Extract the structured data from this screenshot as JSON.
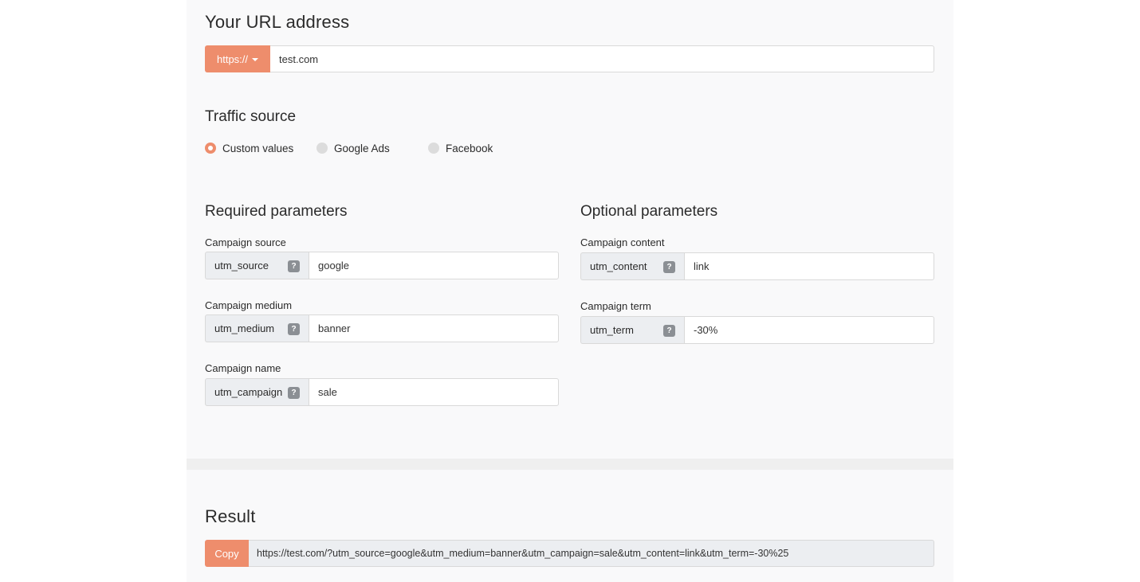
{
  "url_section": {
    "title": "Your URL address",
    "protocol_label": "https://",
    "url_value": "test.com"
  },
  "traffic": {
    "title": "Traffic source",
    "options": [
      {
        "label": "Custom values",
        "checked": true
      },
      {
        "label": "Google Ads",
        "checked": false
      },
      {
        "label": "Facebook",
        "checked": false
      }
    ]
  },
  "required": {
    "title": "Required parameters",
    "fields": [
      {
        "label": "Campaign source",
        "key": "utm_source",
        "value": "google"
      },
      {
        "label": "Campaign medium",
        "key": "utm_medium",
        "value": "banner"
      },
      {
        "label": "Campaign name",
        "key": "utm_campaign",
        "value": "sale"
      }
    ]
  },
  "optional": {
    "title": "Optional parameters",
    "fields": [
      {
        "label": "Campaign content",
        "key": "utm_content",
        "value": "link"
      },
      {
        "label": "Campaign term",
        "key": "utm_term",
        "value": "-30%"
      }
    ]
  },
  "help_glyph": "?",
  "result": {
    "title": "Result",
    "copy_label": "Copy",
    "url": "https://test.com/?utm_source=google&utm_medium=banner&utm_campaign=sale&utm_content=link&utm_term=-30%25"
  },
  "colors": {
    "accent": "#ee8d6c",
    "panel_bg": "#f9f9fa",
    "key_bg": "#eceef1",
    "help_icon": "#8b8f94"
  }
}
